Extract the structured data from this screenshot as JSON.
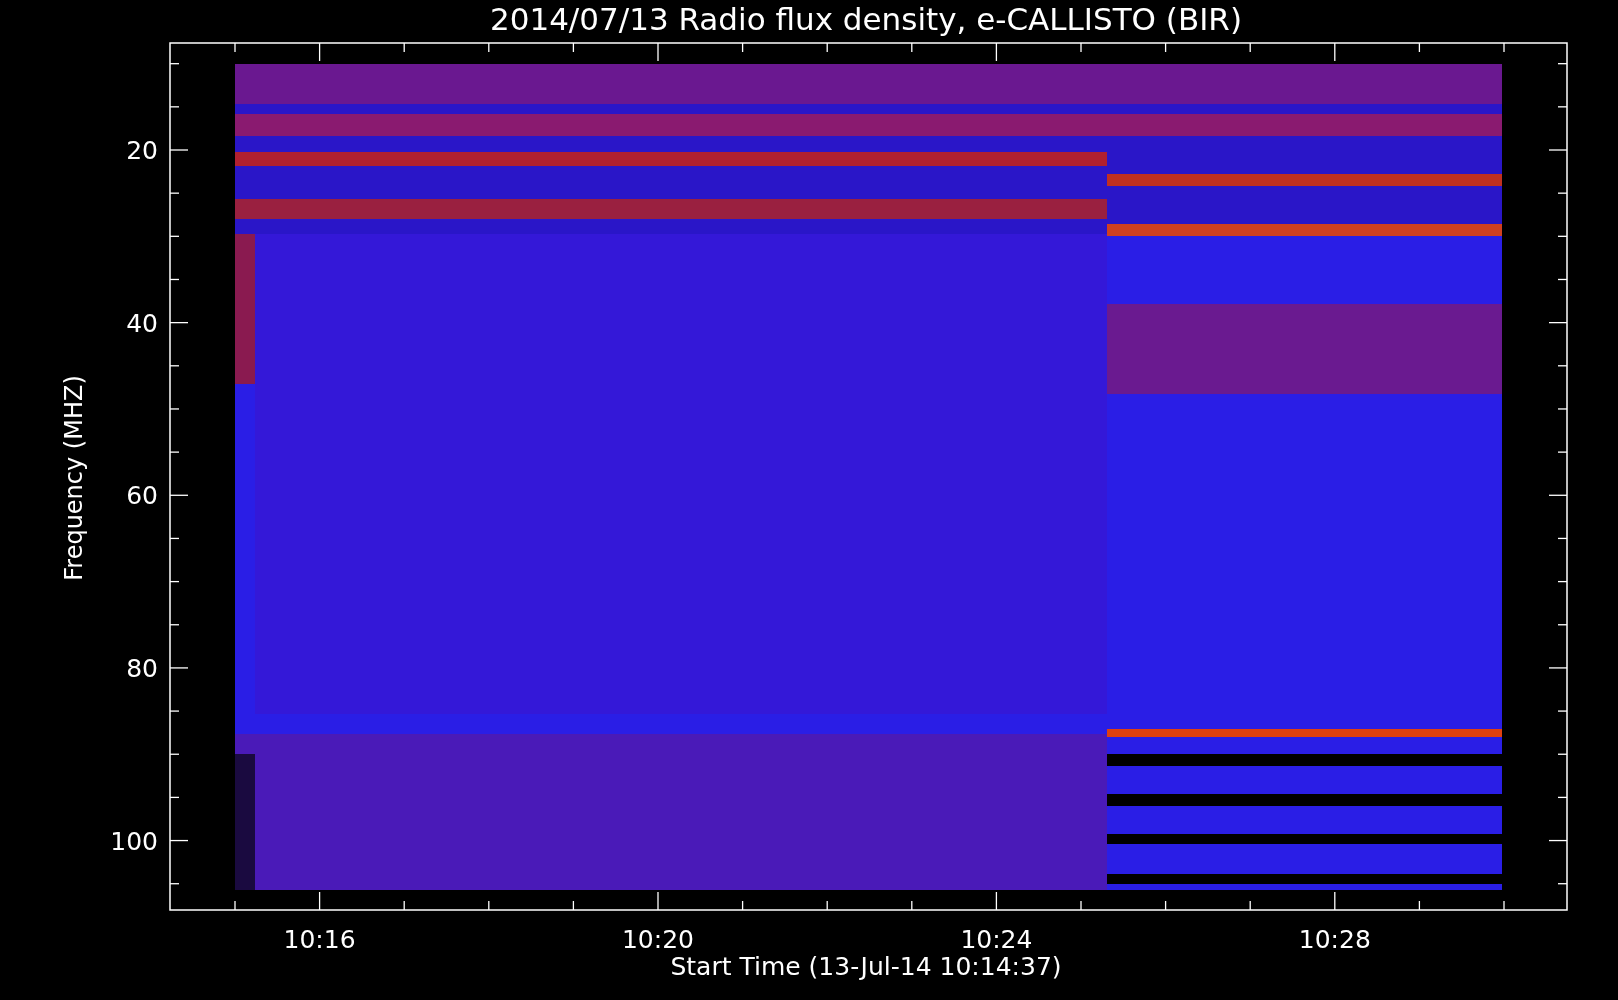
{
  "title": "2014/07/13  Radio flux density, e-CALLISTO (BIR)",
  "ylabel": "Frequency (MHZ)",
  "xlabel": "Start Time (13-Jul-14 10:14:37)",
  "yticks": [
    "20",
    "40",
    "60",
    "80",
    "100"
  ],
  "xticks": [
    "10:16",
    "10:20",
    "10:24",
    "10:28"
  ]
}
